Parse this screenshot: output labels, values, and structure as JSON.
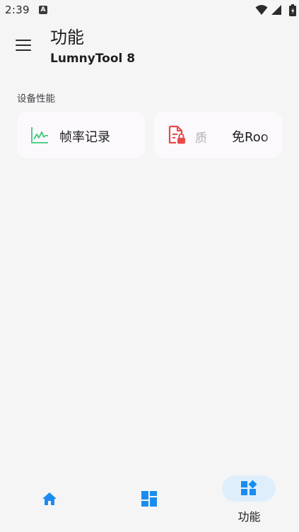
{
  "status_bar": {
    "time": "2:39",
    "notification_icon_letter": "A",
    "icons": [
      "wifi-icon",
      "signal-icon",
      "battery-icon"
    ]
  },
  "app_bar": {
    "menu_icon": "menu-icon",
    "title": "功能",
    "subtitle": "LumnyTool 8"
  },
  "section": {
    "label": "设备性能",
    "cards": [
      {
        "icon": "line-chart-icon",
        "label": "帧率记录",
        "icon_color": "#3cc87a"
      },
      {
        "icon": "document-lock-icon",
        "label_faded": "质",
        "label": "免Roo",
        "icon_color": "#e84a4a"
      }
    ]
  },
  "bottom_nav": {
    "items": [
      {
        "icon": "home-icon",
        "label": "",
        "active": false
      },
      {
        "icon": "dashboard-icon",
        "label": "",
        "active": false
      },
      {
        "icon": "widgets-icon",
        "label": "功能",
        "active": true
      }
    ],
    "accent_color": "#1a8cf0",
    "active_pill_color": "#dfeefb"
  }
}
